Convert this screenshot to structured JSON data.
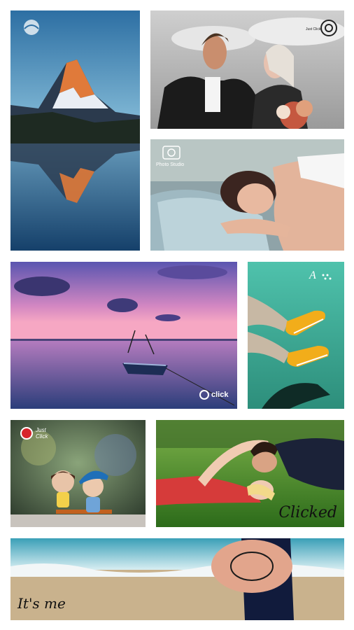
{
  "app": {
    "screen": "photo-grid-collage"
  },
  "watermarks": {
    "sleep": "Photo Studio",
    "sunset": "click",
    "dolls": "Just Click",
    "couple": "Clicked",
    "beach": "It's me",
    "wedding": "Just Click"
  },
  "colors": {
    "background": "#ffffff",
    "sky_top": "#2f73a6",
    "lake": "#1f4f77",
    "sunset_purple": "#6a5bb8",
    "sunset_pink": "#f08fb5",
    "teal": "#3cb3a0",
    "grass": "#4e9a2c",
    "sand": "#c9b28d"
  }
}
